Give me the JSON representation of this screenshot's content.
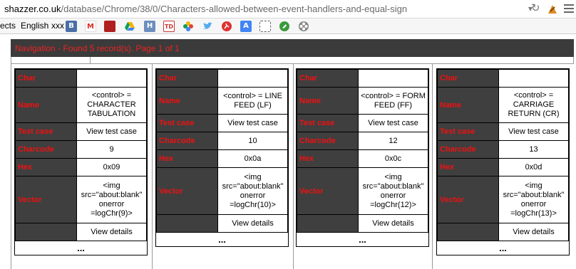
{
  "browser": {
    "url_host": "shazzer.co.uk",
    "url_path": "/database/Chrome/38/0/Characters-allowed-between-event-handlers-and-equal-sign"
  },
  "bookmarks": {
    "partial_label": "ects",
    "english_label": "English",
    "xxx_label": "xxx",
    "icons": [
      {
        "icon": "b-icon",
        "glyph": "B",
        "color": "#4a6fa5"
      },
      {
        "icon": "gmail-icon",
        "glyph": "M",
        "color": "#ffffff"
      },
      {
        "icon": "book-icon",
        "glyph": "",
        "color": "#b01e1e"
      },
      {
        "icon": "drive-icon",
        "glyph": "",
        "color": "#ffffff"
      },
      {
        "icon": "h-icon",
        "glyph": "H",
        "color": "#6c8ebf"
      },
      {
        "icon": "td-icon",
        "glyph": "TD",
        "color": "#ffffff"
      },
      {
        "icon": "flower-icon",
        "glyph": "",
        "color": "#ffffff"
      },
      {
        "icon": "twitter-icon",
        "glyph": "",
        "color": "#ffffff"
      },
      {
        "icon": "runner-icon",
        "glyph": "",
        "color": "#ffffff"
      },
      {
        "icon": "translate-icon",
        "glyph": "A",
        "color": "#4285f4"
      },
      {
        "icon": "square-icon",
        "glyph": "",
        "color": "#ffffff"
      },
      {
        "icon": "green-icon",
        "glyph": "",
        "color": "#3a9a3a"
      },
      {
        "icon": "reel-icon",
        "glyph": "",
        "color": "#ffffff"
      }
    ]
  },
  "navigation": {
    "text": "Navigation - Found 5 record(s). Page 1 of 1"
  },
  "labels": {
    "char": "Char",
    "name": "Name",
    "test_case": "Test case",
    "charcode": "Charcode",
    "hex": "Hex",
    "vector": "Vector",
    "view_test_case": "View test case",
    "view_details": "View details",
    "more": "..."
  },
  "records": [
    {
      "char": "",
      "name": "<control> = CHARACTER TABULATION",
      "charcode": "9",
      "hex": "0x09",
      "vector": "<img src=\"about:blank\" onerror =logChr(9)>"
    },
    {
      "char": "",
      "name": "<control> = LINE FEED (LF)",
      "charcode": "10",
      "hex": "0x0a",
      "vector": "<img src=\"about:blank\" onerror =logChr(10)>"
    },
    {
      "char": "",
      "name": "<control> = FORM FEED (FF)",
      "charcode": "12",
      "hex": "0x0c",
      "vector": "<img src=\"about:blank\" onerror =logChr(12)>"
    },
    {
      "char": "",
      "name": "<control> = CARRIAGE RETURN (CR)",
      "charcode": "13",
      "hex": "0x0d",
      "vector": "<img src=\"about:blank\" onerror =logChr(13)>"
    }
  ],
  "colors": {
    "key_background": "#3f3f3f",
    "key_text": "#ee1111",
    "nav_background": "#3b3b3b"
  }
}
